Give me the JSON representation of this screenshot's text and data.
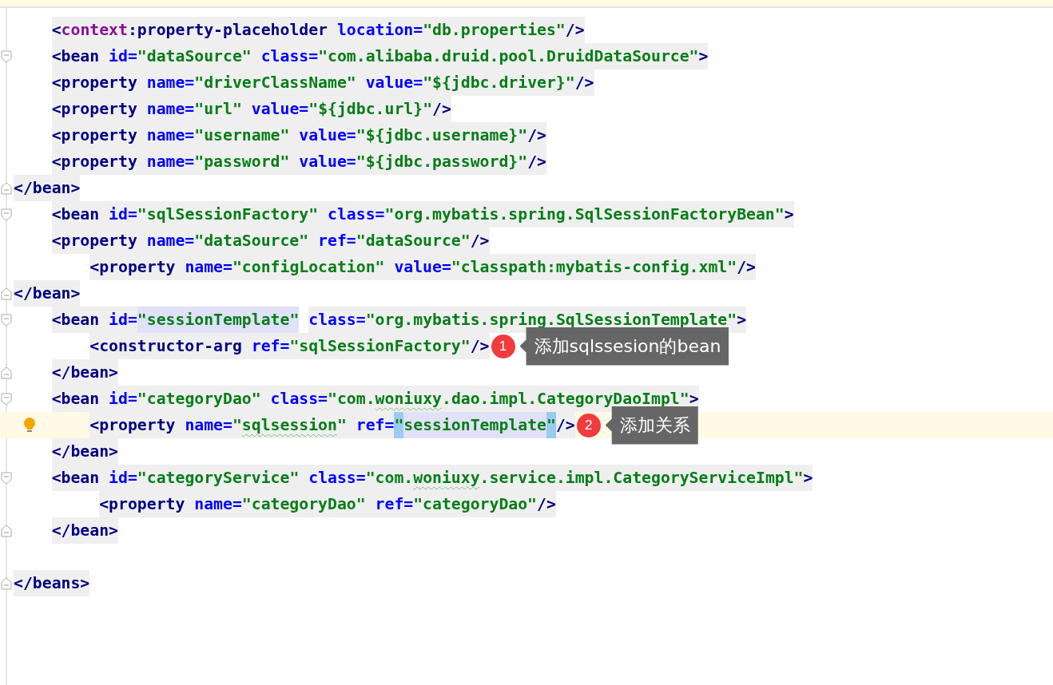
{
  "editor": {
    "lines": [
      {
        "current": false,
        "tokens": [
          {
            "text": "    <",
            "kind": "tag"
          },
          {
            "text": "context",
            "kind": "ns"
          },
          {
            "text": ":property-placeholder ",
            "kind": "tag"
          },
          {
            "text": "location=",
            "kind": "attr"
          },
          {
            "text": "\"db.properties\"",
            "kind": "val"
          },
          {
            "text": "/>",
            "kind": "tag"
          }
        ]
      },
      {
        "current": false,
        "fold_start": true,
        "tokens": [
          {
            "text": "    <bean ",
            "kind": "tag"
          },
          {
            "text": "id=",
            "kind": "attr"
          },
          {
            "text": "\"dataSource\" ",
            "kind": "val"
          },
          {
            "text": "class=",
            "kind": "attr"
          },
          {
            "text": "\"com.alibaba.druid.pool.DruidDataSource\"",
            "kind": "val"
          },
          {
            "text": ">",
            "kind": "tag"
          }
        ]
      },
      {
        "current": false,
        "tokens": [
          {
            "text": "    <property ",
            "kind": "tag"
          },
          {
            "text": "name=",
            "kind": "attr"
          },
          {
            "text": "\"driverClassName\" ",
            "kind": "val"
          },
          {
            "text": "value=",
            "kind": "attr"
          },
          {
            "text": "\"${jdbc.driver}\"",
            "kind": "val"
          },
          {
            "text": "/>",
            "kind": "tag"
          }
        ]
      },
      {
        "current": false,
        "tokens": [
          {
            "text": "    <property ",
            "kind": "tag"
          },
          {
            "text": "name=",
            "kind": "attr"
          },
          {
            "text": "\"url\" ",
            "kind": "val"
          },
          {
            "text": "value=",
            "kind": "attr"
          },
          {
            "text": "\"${jdbc.url}\"",
            "kind": "val"
          },
          {
            "text": "/>",
            "kind": "tag"
          }
        ]
      },
      {
        "current": false,
        "tokens": [
          {
            "text": "    <property ",
            "kind": "tag"
          },
          {
            "text": "name=",
            "kind": "attr"
          },
          {
            "text": "\"username\" ",
            "kind": "val"
          },
          {
            "text": "value=",
            "kind": "attr"
          },
          {
            "text": "\"${jdbc.username}\"",
            "kind": "val"
          },
          {
            "text": "/>",
            "kind": "tag"
          }
        ]
      },
      {
        "current": false,
        "tokens": [
          {
            "text": "    <property ",
            "kind": "tag"
          },
          {
            "text": "name=",
            "kind": "attr"
          },
          {
            "text": "\"password\" ",
            "kind": "val"
          },
          {
            "text": "value=",
            "kind": "attr"
          },
          {
            "text": "\"${jdbc.password}\"",
            "kind": "val"
          },
          {
            "text": "/>",
            "kind": "tag"
          }
        ]
      },
      {
        "current": false,
        "fold_end": true,
        "tokens": [
          {
            "text": "</bean>",
            "kind": "tag"
          }
        ]
      },
      {
        "current": false,
        "fold_start": true,
        "tokens": [
          {
            "text": "    <bean ",
            "kind": "tag"
          },
          {
            "text": "id=",
            "kind": "attr"
          },
          {
            "text": "\"sqlSessionFactory\" ",
            "kind": "val"
          },
          {
            "text": "class=",
            "kind": "attr"
          },
          {
            "text": "\"org.mybatis.spring.SqlSessionFactoryBean\"",
            "kind": "val"
          },
          {
            "text": ">",
            "kind": "tag"
          }
        ]
      },
      {
        "current": false,
        "tokens": [
          {
            "text": "    <property ",
            "kind": "tag"
          },
          {
            "text": "name=",
            "kind": "attr"
          },
          {
            "text": "\"dataSource\" ",
            "kind": "val"
          },
          {
            "text": "ref=",
            "kind": "attr"
          },
          {
            "text": "\"dataSource\"",
            "kind": "val"
          },
          {
            "text": "/>",
            "kind": "tag"
          }
        ]
      },
      {
        "current": false,
        "tokens": [
          {
            "text": "        <property ",
            "kind": "tag"
          },
          {
            "text": "name=",
            "kind": "attr"
          },
          {
            "text": "\"configLocation\" ",
            "kind": "val"
          },
          {
            "text": "value=",
            "kind": "attr"
          },
          {
            "text": "\"classpath:mybatis-config.xml\"",
            "kind": "val"
          },
          {
            "text": "/>",
            "kind": "tag"
          }
        ]
      },
      {
        "current": false,
        "fold_end": true,
        "tokens": [
          {
            "text": "</bean>",
            "kind": "tag"
          }
        ]
      },
      {
        "current": false,
        "fold_start": true,
        "tokens": [
          {
            "text": "    <bean ",
            "kind": "tag"
          },
          {
            "text": "id=",
            "kind": "attr"
          },
          {
            "text": "\"sessionTemplate\"",
            "kind": "val",
            "usage_highlight": true
          },
          {
            "text": " class=",
            "kind": "attr"
          },
          {
            "text": "\"org.mybatis.spring.SqlSessionTemplate\"",
            "kind": "val"
          },
          {
            "text": ">",
            "kind": "tag"
          }
        ]
      },
      {
        "current": false,
        "tokens": [
          {
            "text": "        <constructor-arg ",
            "kind": "tag"
          },
          {
            "text": "ref=",
            "kind": "attr"
          },
          {
            "text": "\"sqlSessionFactory\"",
            "kind": "val"
          },
          {
            "text": "/>",
            "kind": "tag"
          }
        ],
        "callout": {
          "number": "1",
          "text": "添加sqlssesion的bean"
        }
      },
      {
        "current": false,
        "fold_end": true,
        "tokens": [
          {
            "text": "    </bean>",
            "kind": "tag"
          }
        ]
      },
      {
        "current": false,
        "fold_start": true,
        "tokens": [
          {
            "text": "    <bean ",
            "kind": "tag"
          },
          {
            "text": "id=",
            "kind": "attr"
          },
          {
            "text": "\"categoryDao\" ",
            "kind": "val"
          },
          {
            "text": "class=",
            "kind": "attr"
          },
          {
            "text": "\"com.",
            "kind": "val"
          },
          {
            "text": "woniuxy",
            "kind": "val",
            "typo": true
          },
          {
            "text": ".dao.impl.CategoryDaoImpl\"",
            "kind": "val"
          },
          {
            "text": ">",
            "kind": "tag"
          }
        ]
      },
      {
        "current": true,
        "bulb": true,
        "tokens": [
          {
            "text": "        <property ",
            "kind": "tag"
          },
          {
            "text": "name=",
            "kind": "attr"
          },
          {
            "text": "\"",
            "kind": "val"
          },
          {
            "text": "sqlsession",
            "kind": "val",
            "typo": true
          },
          {
            "text": "\" ",
            "kind": "val"
          },
          {
            "text": "ref=",
            "kind": "attr"
          },
          {
            "text": "\"",
            "kind": "val",
            "brace_highlight": true
          },
          {
            "text": "sessionTemplate",
            "kind": "val",
            "usage_highlight": true
          },
          {
            "text": "\"",
            "kind": "val",
            "brace_highlight": true
          },
          {
            "text": "/>",
            "kind": "tag"
          }
        ],
        "callout": {
          "number": "2",
          "text": "添加关系"
        }
      },
      {
        "current": false,
        "tokens": [
          {
            "text": "    </bean>",
            "kind": "tag"
          }
        ]
      },
      {
        "current": false,
        "fold_start": true,
        "tokens": [
          {
            "text": "    <bean ",
            "kind": "tag"
          },
          {
            "text": "id=",
            "kind": "attr"
          },
          {
            "text": "\"categoryService\" ",
            "kind": "val"
          },
          {
            "text": "class=",
            "kind": "attr"
          },
          {
            "text": "\"com.",
            "kind": "val"
          },
          {
            "text": "woniuxy",
            "kind": "val",
            "typo": true
          },
          {
            "text": ".service.impl.CategoryServiceImpl\"",
            "kind": "val"
          },
          {
            "text": ">",
            "kind": "tag"
          }
        ]
      },
      {
        "current": false,
        "tokens": [
          {
            "text": "         <property ",
            "kind": "tag"
          },
          {
            "text": "name=",
            "kind": "attr"
          },
          {
            "text": "\"categoryDao\" ",
            "kind": "val"
          },
          {
            "text": "ref=",
            "kind": "attr"
          },
          {
            "text": "\"categoryDao\"",
            "kind": "val"
          },
          {
            "text": "/>",
            "kind": "tag"
          }
        ]
      },
      {
        "current": false,
        "fold_end": true,
        "tokens": [
          {
            "text": "    </bean>",
            "kind": "tag"
          }
        ]
      },
      {
        "current": false
      },
      {
        "current": false,
        "fold_end": true,
        "tokens": [
          {
            "text": "</beans>",
            "kind": "tag"
          }
        ]
      }
    ]
  }
}
